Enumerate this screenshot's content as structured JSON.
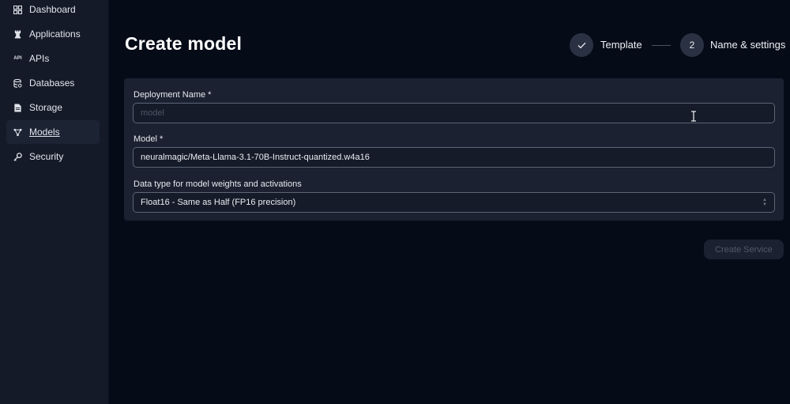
{
  "sidebar": {
    "items": [
      {
        "label": "Dashboard",
        "icon": "dashboard-icon"
      },
      {
        "label": "Applications",
        "icon": "chess-rook-icon"
      },
      {
        "label": "APIs",
        "icon": "api-icon"
      },
      {
        "label": "Databases",
        "icon": "database-icon"
      },
      {
        "label": "Storage",
        "icon": "file-icon"
      },
      {
        "label": "Models",
        "icon": "nodes-icon",
        "active": true
      },
      {
        "label": "Security",
        "icon": "key-icon"
      }
    ],
    "api_icon_text": "API"
  },
  "page": {
    "title": "Create model"
  },
  "stepper": {
    "step1_label": "Template",
    "step2_number": "2",
    "step2_label": "Name & settings"
  },
  "form": {
    "deployment_name_label": "Deployment Name *",
    "deployment_name_placeholder": "model",
    "model_label": "Model *",
    "model_value": "neuralmagic/Meta-Llama-3.1-70B-Instruct-quantized.w4a16",
    "dtype_label": "Data type for model weights and activations",
    "dtype_value": "Float16 - Same as Half (FP16 precision)"
  },
  "actions": {
    "create_service_label": "Create Service"
  },
  "colors": {
    "background": "#050b17",
    "sidebar": "#141a28",
    "card": "#1b2130",
    "input_border": "#5d6475",
    "disabled_text": "#515869"
  }
}
